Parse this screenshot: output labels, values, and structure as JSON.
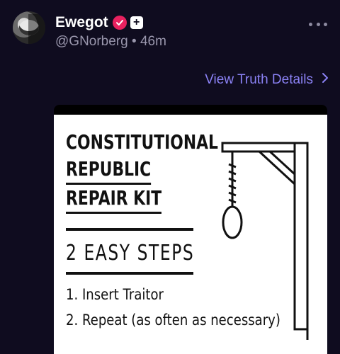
{
  "post": {
    "display_name": "Ewegot",
    "plus_badge": "+",
    "handle": "@GNorberg",
    "separator": "•",
    "time": "46m"
  },
  "actions": {
    "view_details_label": "View Truth Details",
    "chevron": "›"
  },
  "poster": {
    "title_lines": [
      "CONSTITUTIONAL",
      "REPUBLIC",
      "REPAIR KIT"
    ],
    "steps_title": "2 EASY STEPS",
    "step_1": "1. Insert Traitor",
    "step_2": "2. Repeat (as often as necessary)"
  },
  "icons": {
    "verified": "verified-badge-icon",
    "more": "more-horizontal-icon",
    "chevron": "chevron-right-icon"
  },
  "colors": {
    "background": "#0f0c1f",
    "link": "#8b82f5",
    "verified": "#e8215f",
    "muted": "#9a97ad"
  }
}
